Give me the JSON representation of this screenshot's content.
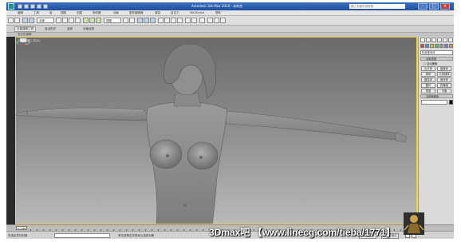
{
  "titlebar": {
    "title": "Autodesk 3ds Max 2010 - 未命名",
    "search_placeholder": "键入关键字或短语",
    "minimize_icon": "minimize-icon",
    "maximize_icon": "maximize-icon",
    "close_icon": "close-icon"
  },
  "menubar": {
    "items": [
      "编辑",
      "工具",
      "组",
      "视图",
      "创建",
      "修改器",
      "动画",
      "图形编辑器",
      "渲染",
      "自定义",
      "MAXScript",
      "帮助"
    ]
  },
  "toolbar": {
    "selection_filter": "全部",
    "coord_system": "视图"
  },
  "ribbon": {
    "tabs": [
      "石墨建模工具",
      "自由形式",
      "选择",
      "对象绘制"
    ],
    "sub_label": "多边形建模"
  },
  "viewport": {
    "label": "[+] [透视] [真实]"
  },
  "command_panel": {
    "category": "标准基本体",
    "rollout_object_type": "对象类型",
    "autogrid_label": "自动栅格",
    "buttons": [
      "长方体",
      "圆锥体",
      "球体",
      "几何球体",
      "圆柱体",
      "管状体",
      "圆环",
      "四棱锥",
      "茶壶",
      "平面"
    ],
    "rollout_name_color": "名称和颜色"
  },
  "timeline": {
    "frame_slider": "0 / 100"
  },
  "statusbar": {
    "selection_info": "未选定任何对象",
    "prompt": "单击或单击并拖动以选择对象",
    "autokey_label": "自动关键点",
    "setkey_label": "设置关键点"
  },
  "watermark": {
    "text": "3Dmax吧 【www.linecg.com/tieba/1771】"
  },
  "colors": {
    "viewport_border": "#f1d23a",
    "title_bar": "#2a5aa8",
    "model_gray": "#8e8e8e"
  }
}
